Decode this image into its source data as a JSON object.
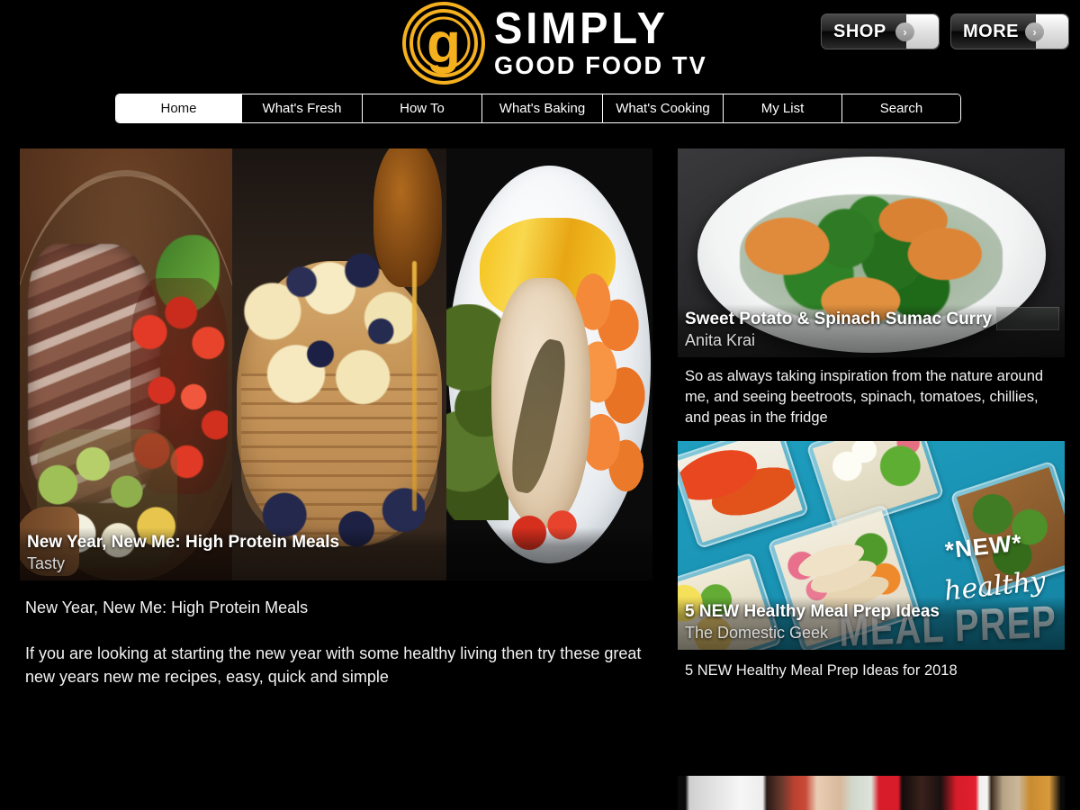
{
  "site": {
    "logo_primary": "SIMPLY",
    "logo_secondary": "GOOD FOOD TV",
    "logo_mark_letter": "g",
    "brand_color": "#F5B01E"
  },
  "header": {
    "buttons": [
      {
        "label": "SHOP",
        "arrow": "›"
      },
      {
        "label": "MORE",
        "arrow": "›"
      }
    ]
  },
  "nav": {
    "items": [
      {
        "label": "Home",
        "active": true
      },
      {
        "label": "What's Fresh",
        "active": false
      },
      {
        "label": "How To",
        "active": false
      },
      {
        "label": "What's Baking",
        "active": false
      },
      {
        "label": "What's Cooking",
        "active": false
      },
      {
        "label": "My List",
        "active": false
      },
      {
        "label": "Search",
        "active": false
      }
    ]
  },
  "feature": {
    "overlay_title": "New Year, New Me: High Protein Meals",
    "overlay_author": "Tasty",
    "headline": "New Year, New Me: High Protein Meals",
    "description": "If you are looking at starting the new year with some healthy living then try these great new years new me recipes, easy, quick and simple"
  },
  "rail": {
    "cards": [
      {
        "overlay_title": "Sweet Potato & Spinach Sumac Curry",
        "overlay_author": "Anita Krai",
        "description": "So as always taking inspiration from the nature around me, and seeing beetroots, spinach, tomatoes, chillies, and peas in the fridge"
      },
      {
        "overlay_title": "5 NEW Healthy Meal Prep Ideas",
        "overlay_author": "The Domestic Geek",
        "description": "5 NEW Healthy Meal Prep Ideas for  2018",
        "image_text": {
          "new": "*NEW*",
          "healthy": "healthy",
          "mealprep": "MEAL PREP"
        }
      }
    ]
  }
}
